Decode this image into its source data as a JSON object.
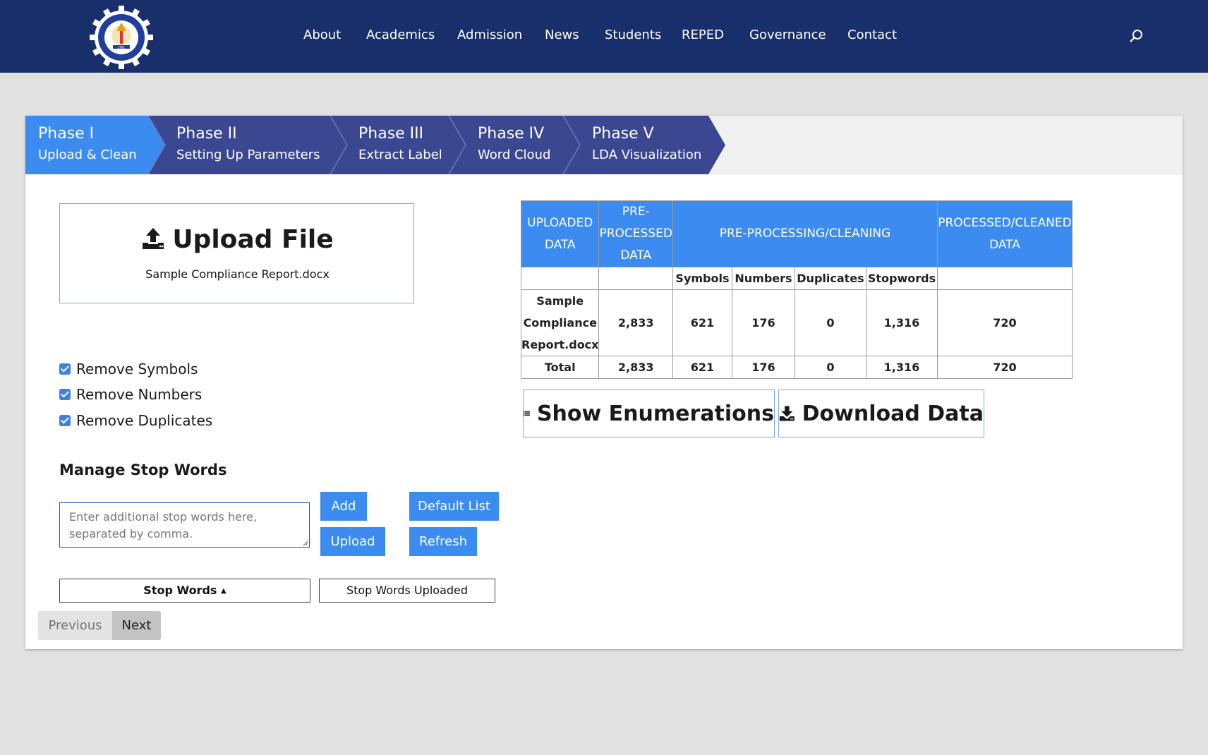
{
  "nav": {
    "logo_text": "Marikina Polytechnic College 1981",
    "items": [
      "About",
      "Academics",
      "Admission",
      "News",
      "Students",
      "REPED",
      "Governance",
      "Contact"
    ]
  },
  "steps": [
    {
      "title": "Phase I",
      "subtitle": "Upload & Clean"
    },
    {
      "title": "Phase II",
      "subtitle": "Setting Up Parameters"
    },
    {
      "title": "Phase III",
      "subtitle": "Extract Label"
    },
    {
      "title": "Phase IV",
      "subtitle": "Word Cloud"
    },
    {
      "title": "Phase V",
      "subtitle": "LDA Visualization"
    }
  ],
  "upload": {
    "title": "Upload File",
    "filename": "Sample Compliance Report.docx"
  },
  "options": {
    "remove_symbols": "Remove Symbols",
    "remove_numbers": "Remove Numbers",
    "remove_duplicates": "Remove Duplicates"
  },
  "stopwords": {
    "title": "Manage Stop Words",
    "placeholder": "Enter additional stop words here, separated by comma.",
    "add": "Add",
    "upload": "Upload",
    "default_list": "Default List",
    "refresh": "Refresh",
    "tab_stop_words": "Stop Words",
    "tab_uploaded": "Stop Words Uploaded"
  },
  "pager": {
    "previous": "Previous",
    "next": "Next"
  },
  "table": {
    "headers": {
      "uploaded_1": "UPLOADED",
      "uploaded_2": "DATA",
      "pre_1": "PRE-",
      "pre_2": "PROCESSED",
      "pre_3": "DATA",
      "cleaning": "PRE-PROCESSING/CLEANING",
      "processed_1": "PROCESSED/CLEANED",
      "processed_2": "DATA"
    },
    "subheaders": {
      "symbols": "Symbols",
      "numbers": "Numbers",
      "duplicates": "Duplicates",
      "stopwords": "Stopwords"
    },
    "rows": [
      {
        "name_1": "Sample",
        "name_2": "Compliance",
        "name_3": "Report.docx",
        "pre": "2,833",
        "symbols": "621",
        "numbers": "176",
        "duplicates": "0",
        "stopwords": "1,316",
        "cleaned": "720"
      }
    ],
    "total": {
      "label": "Total",
      "pre": "2,833",
      "symbols": "621",
      "numbers": "176",
      "duplicates": "0",
      "stopwords": "1,316",
      "cleaned": "720"
    }
  },
  "actions": {
    "show_enumerations": "Show Enumerations",
    "download_data": "Download Data"
  },
  "colors": {
    "navbar": "#182f6b",
    "step_active": "#3b8bf0",
    "step_inactive": "#3b4891",
    "accent": "#3b8bf0"
  }
}
